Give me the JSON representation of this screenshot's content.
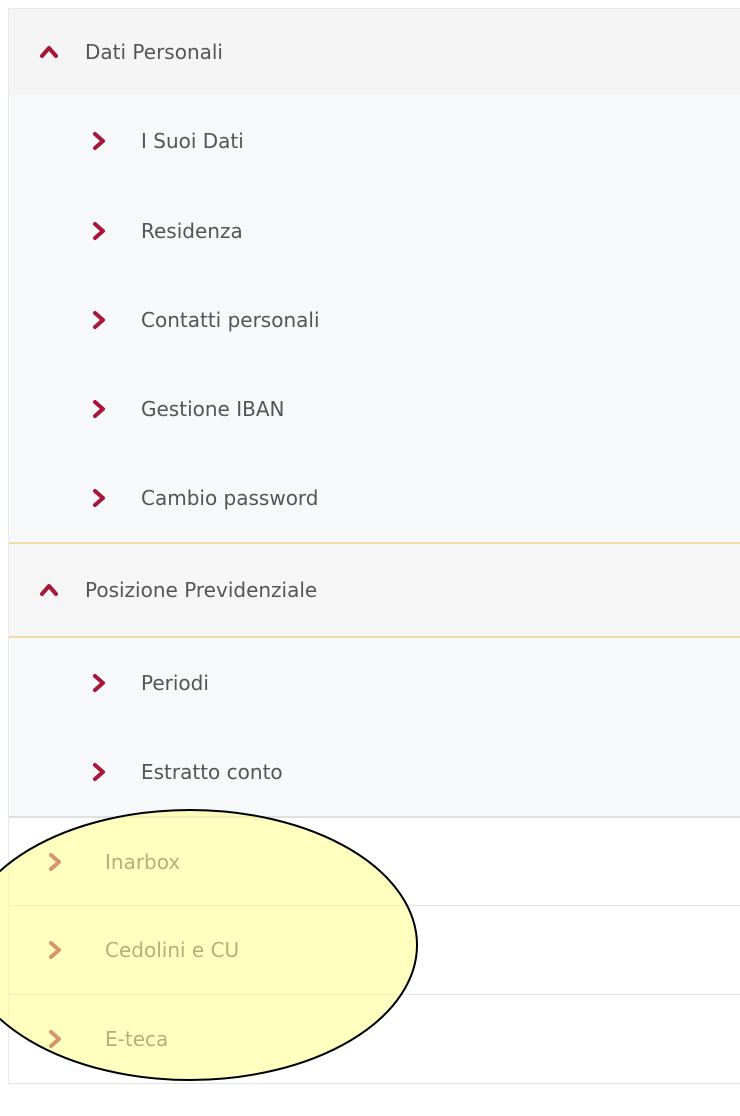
{
  "menu": {
    "dati_personali": {
      "label": "Dati Personali",
      "icon": "chevron-up-icon",
      "items": [
        {
          "label": "I Suoi Dati",
          "icon": "chevron-right-icon"
        },
        {
          "label": "Residenza",
          "icon": "chevron-right-icon"
        },
        {
          "label": "Contatti personali",
          "icon": "chevron-right-icon"
        },
        {
          "label": "Gestione IBAN",
          "icon": "chevron-right-icon"
        },
        {
          "label": "Cambio password",
          "icon": "chevron-right-icon"
        }
      ]
    },
    "posizione_previdenziale": {
      "label": "Posizione Previdenziale",
      "icon": "chevron-up-icon",
      "items": [
        {
          "label": "Periodi",
          "icon": "chevron-right-icon"
        },
        {
          "label": "Estratto conto",
          "icon": "chevron-right-icon"
        }
      ]
    },
    "top_items": [
      {
        "label": "Inarbox",
        "icon": "chevron-right-icon"
      },
      {
        "label": "Cedolini e CU",
        "icon": "chevron-right-icon"
      },
      {
        "label": "E-teca",
        "icon": "chevron-right-icon"
      }
    ]
  },
  "colors": {
    "accent": "#a6173a",
    "text": "#555555",
    "header_bg": "#f5f5f5",
    "sub_bg": "#f7f8fa",
    "highlight_border": "#f4d9a9",
    "annotation_fill": "#ffff8c"
  }
}
